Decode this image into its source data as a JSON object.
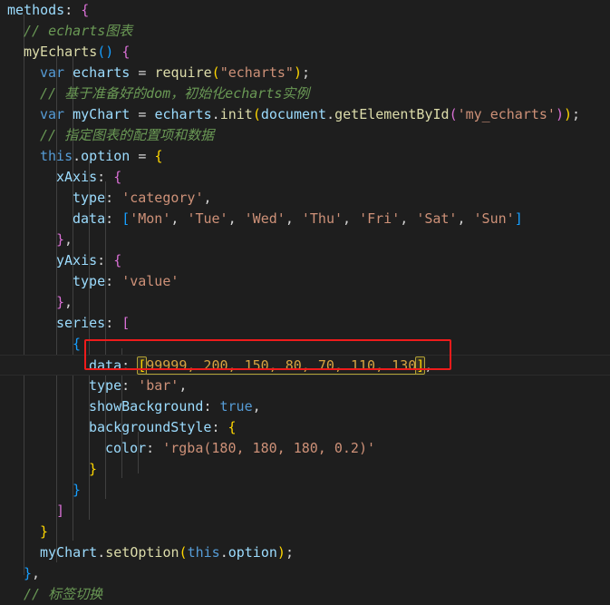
{
  "editor": {
    "language": "javascript",
    "theme": "dark-plus",
    "background_color": "#1e1e1e",
    "foreground_color": "#d4d4d4",
    "font_size_px": 15,
    "line_height_px": 23,
    "current_line": 17
  },
  "annotation": {
    "type": "red-rectangle",
    "color": "#ef1b1b",
    "targets_line": 17,
    "target_text": "data: [99999, 200, 150, 80, 70, 110, 130],"
  },
  "bracket_match": {
    "open": "[",
    "close": "]",
    "highlight_color": "#b3a337",
    "contents": "99999, 200, 150, 80, 70, 110, 130"
  },
  "code": {
    "lines": [
      {
        "n": 1,
        "indent": 0,
        "text": "methods: {"
      },
      {
        "n": 2,
        "indent": 1,
        "text": "// echarts图表"
      },
      {
        "n": 3,
        "indent": 1,
        "text": "myEcharts() {"
      },
      {
        "n": 4,
        "indent": 2,
        "text": "var echarts = require(\"echarts\");"
      },
      {
        "n": 5,
        "indent": 2,
        "text": "// 基于准备好的dom，初始化echarts实例"
      },
      {
        "n": 6,
        "indent": 2,
        "text": "var myChart = echarts.init(document.getElementById('my_echarts'));"
      },
      {
        "n": 7,
        "indent": 2,
        "text": "// 指定图表的配置项和数据"
      },
      {
        "n": 8,
        "indent": 2,
        "text": "this.option = {"
      },
      {
        "n": 9,
        "indent": 3,
        "text": "xAxis: {"
      },
      {
        "n": 10,
        "indent": 4,
        "text": "type: 'category',"
      },
      {
        "n": 11,
        "indent": 4,
        "text": "data: ['Mon', 'Tue', 'Wed', 'Thu', 'Fri', 'Sat', 'Sun']"
      },
      {
        "n": 12,
        "indent": 3,
        "text": "},"
      },
      {
        "n": 13,
        "indent": 3,
        "text": "yAxis: {"
      },
      {
        "n": 14,
        "indent": 4,
        "text": "type: 'value'"
      },
      {
        "n": 15,
        "indent": 3,
        "text": "},"
      },
      {
        "n": 16,
        "indent": 3,
        "text": "series: ["
      },
      {
        "n": 17,
        "indent": 4,
        "text": "{"
      },
      {
        "n": 18,
        "indent": 5,
        "text": "data: [99999, 200, 150, 80, 70, 110, 130],"
      },
      {
        "n": 19,
        "indent": 5,
        "text": "type: 'bar',"
      },
      {
        "n": 20,
        "indent": 5,
        "text": "showBackground: true,"
      },
      {
        "n": 21,
        "indent": 5,
        "text": "backgroundStyle: {"
      },
      {
        "n": 22,
        "indent": 6,
        "text": "color: 'rgba(180, 180, 180, 0.2)'"
      },
      {
        "n": 23,
        "indent": 5,
        "text": "}"
      },
      {
        "n": 24,
        "indent": 4,
        "text": "}"
      },
      {
        "n": 25,
        "indent": 3,
        "text": "]"
      },
      {
        "n": 26,
        "indent": 2,
        "text": "}"
      },
      {
        "n": 27,
        "indent": 2,
        "text": "myChart.setOption(this.option);"
      },
      {
        "n": 28,
        "indent": 1,
        "text": "},"
      },
      {
        "n": 29,
        "indent": 1,
        "text": "// 标签切换"
      }
    ]
  },
  "tokens": {
    "l1_methods": "methods",
    "l1_colon": ": ",
    "l1_brace": "{",
    "l2_comment": "// echarts图表",
    "l3_fn": "myEcharts",
    "l3_parens": "()",
    "l3_brace": " {",
    "l4_var": "var",
    "l4_name": " echarts ",
    "l4_eq": "= ",
    "l4_require": "require",
    "l4_open": "(",
    "l4_str": "\"echarts\"",
    "l4_close": ")",
    "l4_semi": ";",
    "l5_comment": "// 基于准备好的dom，初始化echarts实例",
    "l6_var": "var",
    "l6_name": " myChart ",
    "l6_eq": "= ",
    "l6_obj": "echarts",
    "l6_dot": ".",
    "l6_init": "init",
    "l6_p1": "(",
    "l6_doc": "document",
    "l6_dot2": ".",
    "l6_get": "getElementById",
    "l6_p2": "(",
    "l6_str": "'my_echarts'",
    "l6_p2c": ")",
    "l6_p1c": ")",
    "l6_semi": ";",
    "l7_comment": "// 指定图表的配置项和数据",
    "l8_this": "this",
    "l8_dot": ".",
    "l8_option": "option",
    "l8_eq": " = ",
    "l8_brace": "{",
    "l9_key": "xAxis",
    "l9_colon": ": ",
    "l9_brace": "{",
    "l10_key": "type",
    "l10_colon": ": ",
    "l10_str": "'category'",
    "l10_comma": ",",
    "l11_key": "data",
    "l11_colon": ": ",
    "l11_open": "[",
    "l11_mon": "'Mon'",
    "l11_c1": ", ",
    "l11_tue": "'Tue'",
    "l11_c2": ", ",
    "l11_wed": "'Wed'",
    "l11_c3": ", ",
    "l11_thu": "'Thu'",
    "l11_c4": ", ",
    "l11_fri": "'Fri'",
    "l11_c5": ", ",
    "l11_sat": "'Sat'",
    "l11_c6": ", ",
    "l11_sun": "'Sun'",
    "l11_close": "]",
    "l12_brace": "}",
    "l12_comma": ",",
    "l13_key": "yAxis",
    "l13_colon": ": ",
    "l13_brace": "{",
    "l14_key": "type",
    "l14_colon": ": ",
    "l14_str": "'value'",
    "l15_brace": "}",
    "l15_comma": ",",
    "l16_key": "series",
    "l16_colon": ": ",
    "l16_bracket": "[",
    "l17_brace": "{",
    "l18_key": "data",
    "l18_colon": ": ",
    "l18_open": "[",
    "l18_nums": "99999, 200, 150, 80, 70, 110, 130",
    "l18_close": "]",
    "l18_comma": ",",
    "l19_key": "type",
    "l19_colon": ": ",
    "l19_str": "'bar'",
    "l19_comma": ",",
    "l20_key": "showBackground",
    "l20_colon": ": ",
    "l20_true": "true",
    "l20_comma": ",",
    "l21_key": "backgroundStyle",
    "l21_colon": ": ",
    "l21_brace": "{",
    "l22_key": "color",
    "l22_colon": ": ",
    "l22_str": "'rgba(180, 180, 180, 0.2)'",
    "l23_brace": "}",
    "l24_brace": "}",
    "l25_bracket": "]",
    "l26_brace": "}",
    "l27_obj": "myChart",
    "l27_dot": ".",
    "l27_fn": "setOption",
    "l27_open": "(",
    "l27_this": "this",
    "l27_dot2": ".",
    "l27_option": "option",
    "l27_close": ")",
    "l27_semi": ";",
    "l28_brace": "}",
    "l28_comma": ",",
    "l29_comment": "// 标签切换"
  }
}
